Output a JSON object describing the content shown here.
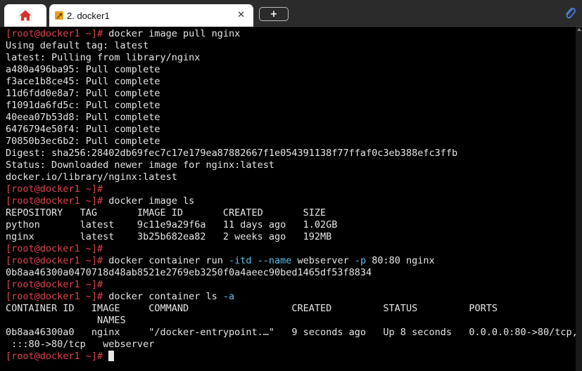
{
  "tabs": {
    "home_icon": "home-icon",
    "active_label": "2. docker1",
    "close_glyph": "✕",
    "new_tab_glyph": "+",
    "attach_icon": "paperclip-icon"
  },
  "colors": {
    "background": "#000000",
    "text": "#e6e6e6",
    "prompt": "#e0434d",
    "option": "#5fc0e8"
  },
  "terminal": {
    "prompt": "[root@docker1 ~]#",
    "lines": [
      [
        {
          "t": "[root@docker1 ~]#",
          "c": "prompt"
        },
        {
          "t": " docker image pull nginx"
        }
      ],
      [
        {
          "t": "Using default tag: latest"
        }
      ],
      [
        {
          "t": "latest: Pulling from library/nginx"
        }
      ],
      [
        {
          "t": "a480a496ba95: Pull complete"
        }
      ],
      [
        {
          "t": "f3ace1b8ce45: Pull complete"
        }
      ],
      [
        {
          "t": "11d6fdd0e8a7: Pull complete"
        }
      ],
      [
        {
          "t": "f1091da6fd5c: Pull complete"
        }
      ],
      [
        {
          "t": "40eea07b53d8: Pull complete"
        }
      ],
      [
        {
          "t": "6476794e50f4: Pull complete"
        }
      ],
      [
        {
          "t": "70850b3ec6b2: Pull complete"
        }
      ],
      [
        {
          "t": "Digest: sha256:28402db69fec7c17e179ea87882667f1e054391138f77ffaf0c3eb388efc3ffb"
        }
      ],
      [
        {
          "t": "Status: Downloaded newer image for nginx:latest"
        }
      ],
      [
        {
          "t": "docker.io/library/nginx:latest"
        }
      ],
      [
        {
          "t": "[root@docker1 ~]#",
          "c": "prompt"
        }
      ],
      [
        {
          "t": "[root@docker1 ~]#",
          "c": "prompt"
        },
        {
          "t": " docker image ls"
        }
      ],
      [
        {
          "t": "REPOSITORY   TAG       IMAGE ID       CREATED       SIZE"
        }
      ],
      [
        {
          "t": "python       latest    9c11e9a29f6a   11 days ago   1.02GB"
        }
      ],
      [
        {
          "t": "nginx        latest    3b25b682ea82   2 weeks ago   192MB"
        }
      ],
      [
        {
          "t": "[root@docker1 ~]#",
          "c": "prompt"
        }
      ],
      [
        {
          "t": "[root@docker1 ~]#",
          "c": "prompt"
        },
        {
          "t": " docker container run "
        },
        {
          "t": "-itd",
          "c": "opt"
        },
        {
          "t": " "
        },
        {
          "t": "--name",
          "c": "opt"
        },
        {
          "t": " webserver "
        },
        {
          "t": "-p",
          "c": "opt"
        },
        {
          "t": " 80:80 nginx"
        }
      ],
      [
        {
          "t": "0b8aa46300a0470718d48ab8521e2769eb3250f0a4aeec90bed1465df53f8834"
        }
      ],
      [
        {
          "t": "[root@docker1 ~]#",
          "c": "prompt"
        }
      ],
      [
        {
          "t": "[root@docker1 ~]#",
          "c": "prompt"
        },
        {
          "t": " docker container ls "
        },
        {
          "t": "-a",
          "c": "opt"
        }
      ],
      [
        {
          "t": "CONTAINER ID   IMAGE     COMMAND                  CREATED         STATUS         PORTS"
        }
      ],
      [
        {
          "t": "                NAMES"
        }
      ],
      [
        {
          "t": "0b8aa46300a0   nginx     \"/docker-entrypoint.…\"   9 seconds ago   Up 8 seconds   0.0.0.0:80->80/tcp,"
        }
      ],
      [
        {
          "t": " :::80->80/tcp   webserver"
        }
      ],
      [
        {
          "t": "[root@docker1 ~]#",
          "c": "prompt"
        },
        {
          "t": " "
        },
        {
          "cursor": true
        }
      ]
    ]
  }
}
